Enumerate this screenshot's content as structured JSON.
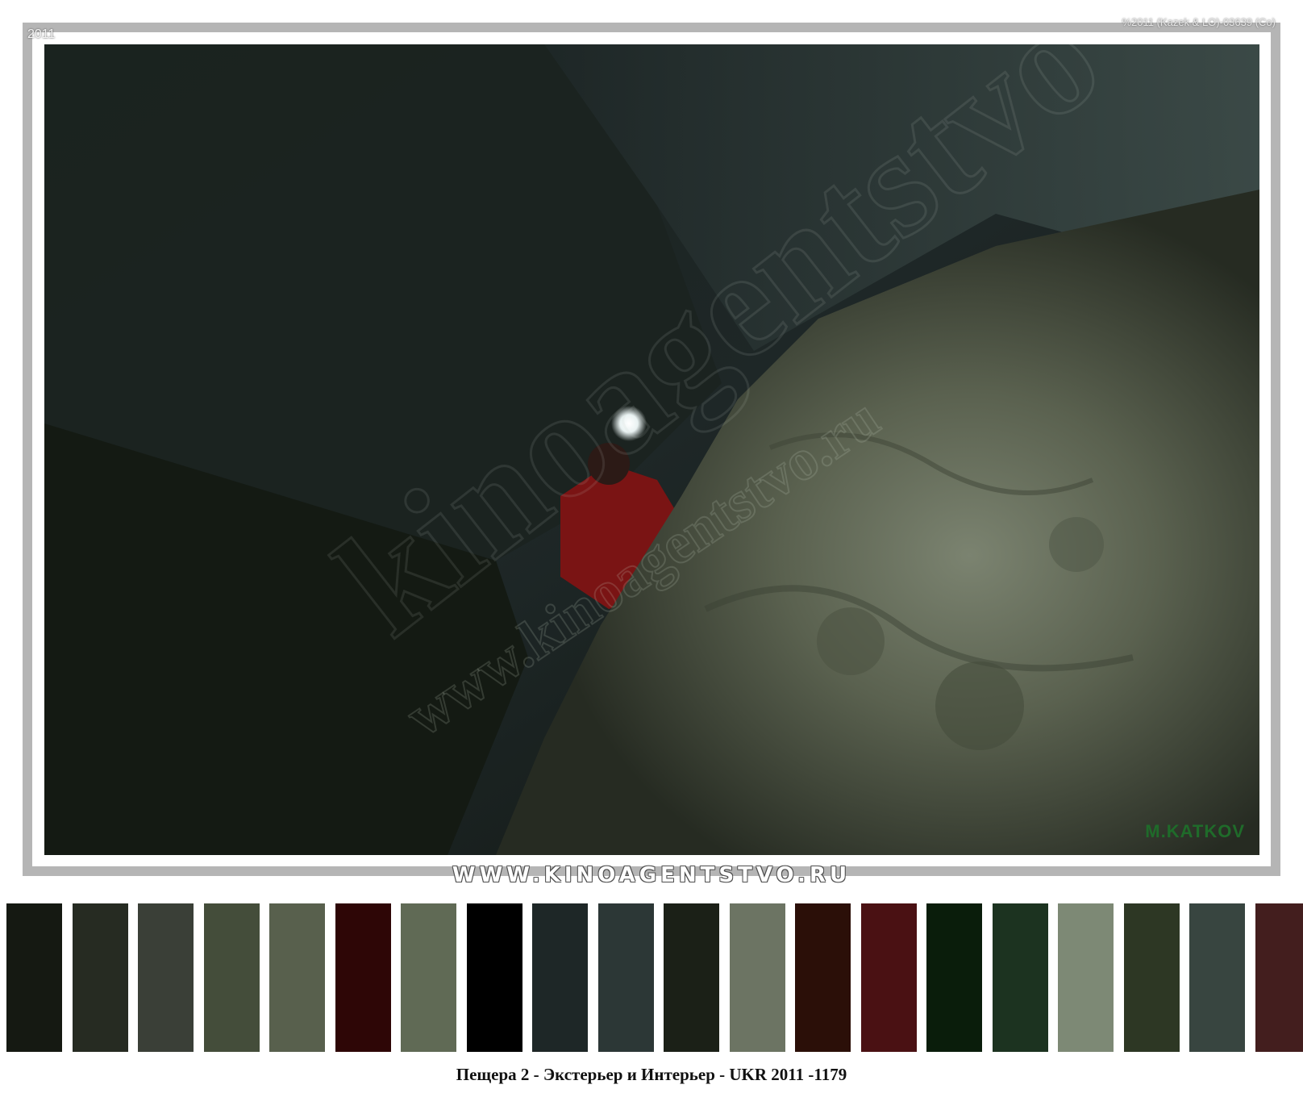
{
  "frame": {
    "year_tag": "2011",
    "credit": "%2011 (Kazek & LO)-03639 (Co)"
  },
  "photo": {
    "subject": "cave-interior-with-person-with-headlamp",
    "signature": "M.KATKOV",
    "watermark_large": "kinoagentstvo",
    "watermark_small": "www.kinoagentstvo.ru"
  },
  "banner": "WWW.KINOAGENTSTVO.RU",
  "palette": [
    "#151912",
    "#262b22",
    "#3a3f37",
    "#444d3a",
    "#58604d",
    "#2e0606",
    "#606a55",
    "#000000",
    "#1e2727",
    "#2c3736",
    "#1b2017",
    "#6c7463",
    "#2b0f08",
    "#4a1113",
    "#0a1d0b",
    "#1c3320",
    "#7d8975",
    "#2d3724",
    "#384540",
    "#431e1e"
  ],
  "caption": "Пещера 2 - Экстерьер и Интерьер - UKR 2011 -1179"
}
